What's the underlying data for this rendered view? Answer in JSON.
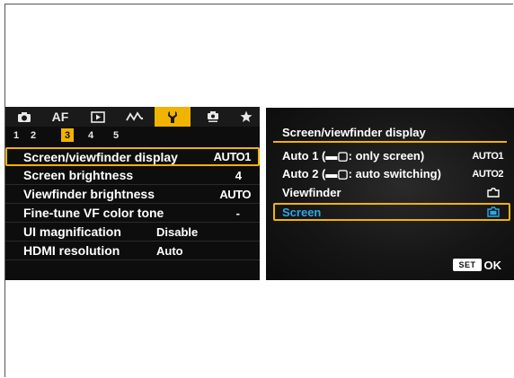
{
  "left_screen": {
    "tabs": [
      {
        "icon": "camera-icon"
      },
      {
        "label": "AF"
      },
      {
        "icon": "playback-icon"
      },
      {
        "icon": "wave-icon"
      },
      {
        "icon": "wrench-icon",
        "active": true
      },
      {
        "icon": "custom-icon"
      },
      {
        "icon": "star-icon"
      }
    ],
    "subtabs": [
      "1",
      "2",
      "3",
      "4",
      "5"
    ],
    "active_subtab": "3",
    "items": [
      {
        "label": "Screen/viewfinder display",
        "value": "AUTO1",
        "selected": true
      },
      {
        "label": "Screen brightness",
        "value": "4"
      },
      {
        "label": "Viewfinder brightness",
        "value": "AUTO"
      },
      {
        "label": "Fine-tune VF color tone",
        "value": "-"
      },
      {
        "label": "UI magnification",
        "value": "Disable"
      },
      {
        "label": "HDMI resolution",
        "value": "Auto"
      }
    ]
  },
  "right_screen": {
    "title": "Screen/viewfinder display",
    "options": [
      {
        "label": "Auto 1 (▬▢: only screen)",
        "value": "AUTO1"
      },
      {
        "label": "Auto 2 (▬▢: auto switching)",
        "value": "AUTO2"
      },
      {
        "label": "Viewfinder",
        "value_icon": "viewfinder-icon"
      },
      {
        "label": "Screen",
        "value_icon": "screen-icon",
        "selected": true
      }
    ],
    "set_label": "SET",
    "ok_label": "OK"
  },
  "colors": {
    "accent": "#f0b400",
    "selected_text": "#2aa8e8",
    "background": "#0d0d0d"
  }
}
